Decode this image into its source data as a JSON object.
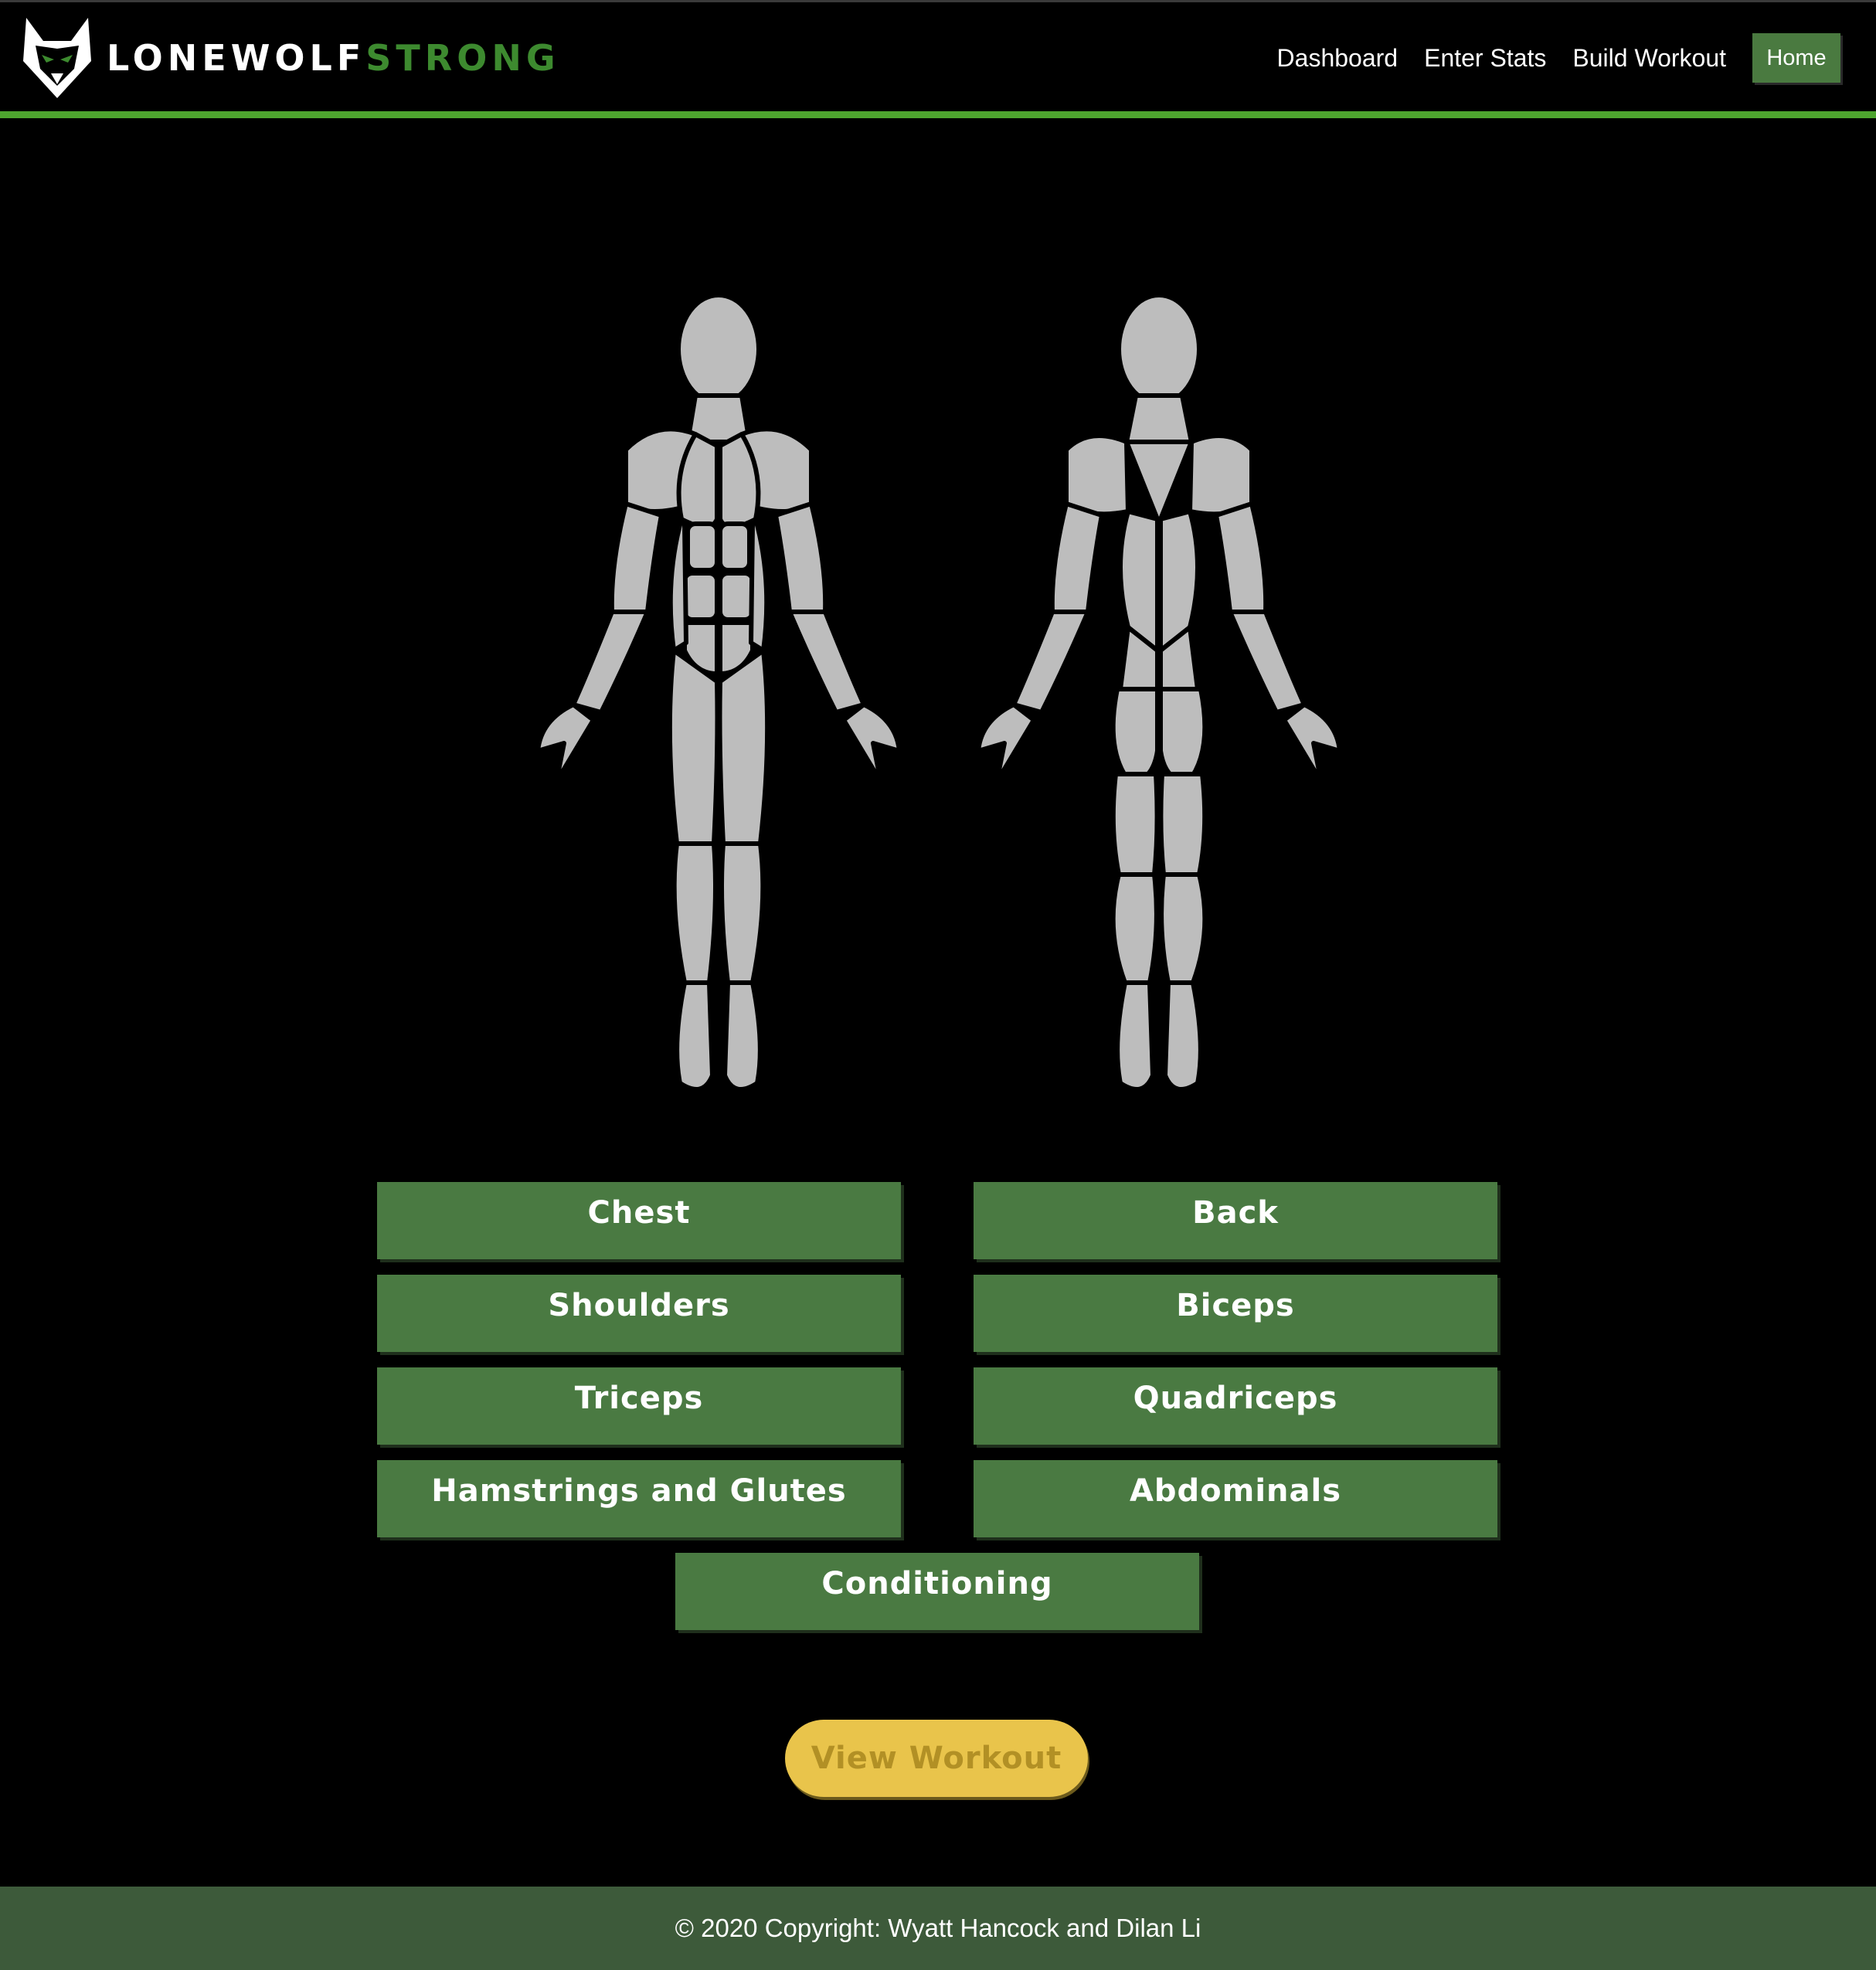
{
  "header": {
    "brand_part1": "LONEWOLF",
    "brand_part2": "STRONG",
    "logo_icon": "wolf-head-logo",
    "nav": [
      "Dashboard",
      "Enter Stats",
      "Build Workout"
    ],
    "home_label": "Home"
  },
  "illustration": {
    "front_icon": "muscle-anatomy-front",
    "back_icon": "muscle-anatomy-back"
  },
  "muscle_groups": {
    "chest": "Chest",
    "back": "Back",
    "shoulders": "Shoulders",
    "biceps": "Biceps",
    "triceps": "Triceps",
    "quadriceps": "Quadriceps",
    "hamstrings": "Hamstrings and Glutes",
    "abdominals": "Abdominals",
    "conditioning": "Conditioning"
  },
  "view_workout_label": "View Workout",
  "footer": {
    "copyright": "© 2020 Copyright: Wyatt Hancock and Dilan Li"
  },
  "colors": {
    "accent_green": "#4ea52f",
    "button_green": "#4a7a42",
    "view_button_yellow": "#e9c44b",
    "footer_bg": "#3d5a3a",
    "figure_gray": "#bdbdbd"
  }
}
